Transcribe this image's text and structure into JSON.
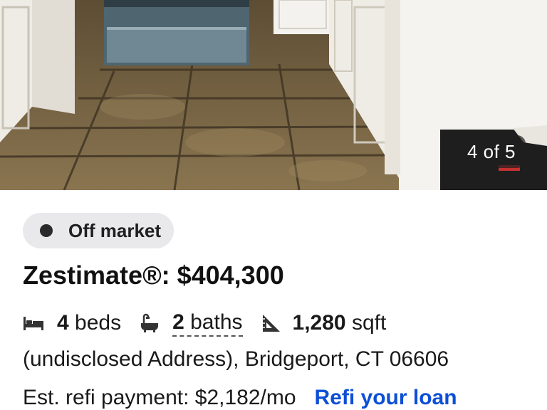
{
  "gallery": {
    "counter": "4 of 5"
  },
  "listing": {
    "status": "Off market",
    "zestimate": "Zestimate®: $404,300",
    "beds_count": "4",
    "beds_label": "beds",
    "baths_count": "2",
    "baths_label": "baths",
    "sqft_count": "1,280",
    "sqft_label": "sqft",
    "address": "(undisclosed Address), Bridgeport, CT 06606",
    "refi_payment": "Est. refi payment: $2,182/mo",
    "refi_link": "Refi your loan"
  },
  "icons": {
    "beds": "bed-icon",
    "baths": "bathtub-icon",
    "sqft": "ruler-triangle-icon"
  },
  "colors": {
    "link": "#0d4fd6",
    "status_pill_bg": "#e9e9ec",
    "counter_bg": "#1e1e1e"
  }
}
